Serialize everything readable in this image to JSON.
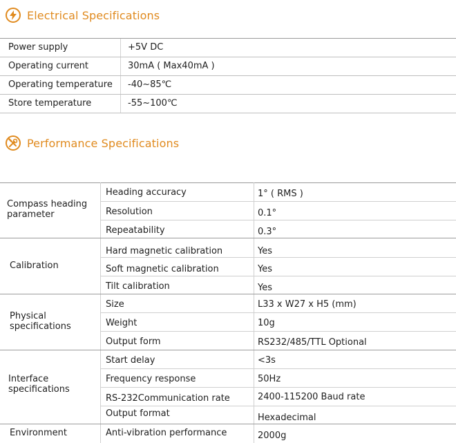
{
  "electrical": {
    "title": "Electrical Specifications",
    "rows": [
      {
        "name": "Power supply",
        "value": "+5V DC"
      },
      {
        "name": "Operating  current",
        "value": "30mA ( Max40mA )"
      },
      {
        "name": "Operating  temperature",
        "value": "-40~85℃"
      },
      {
        "name": "Store temperature",
        "value": "-55~100℃"
      }
    ]
  },
  "performance": {
    "title": "Performance Specifications",
    "groups": [
      {
        "label_lines": [
          "Compass heading",
          "parameter"
        ],
        "rows": [
          {
            "name": "Heading accuracy",
            "value": "1° ( RMS )"
          },
          {
            "name": "Resolution",
            "value": "0.1°"
          },
          {
            "name": "Repeatability",
            "value": "0.3°"
          }
        ]
      },
      {
        "label_lines": [
          "Calibration"
        ],
        "rows": [
          {
            "name": "Hard magnetic calibration",
            "value": "Yes"
          },
          {
            "name": "Soft magnetic calibration",
            "value": "Yes"
          },
          {
            "name": "Tilt calibration",
            "value": "Yes"
          }
        ]
      },
      {
        "label_lines": [
          "Physical",
          "specifications"
        ],
        "rows": [
          {
            "name": "Size",
            "value": "L33 x W27 x H5 (mm)"
          },
          {
            "name": "Weight",
            "value": "10g"
          },
          {
            "name": "Output form",
            "value": "RS232/485/TTL Optional"
          }
        ]
      },
      {
        "label_lines": [
          "Interface",
          "specifications"
        ],
        "rows": [
          {
            "name": "Start delay",
            "value": "<3s"
          },
          {
            "name": "Frequency response",
            "value": "50Hz"
          },
          {
            "name": "RS-232Communication rate",
            "value": "2400-115200 Baud rate"
          },
          {
            "name": "Output format",
            "value": "Hexadecimal"
          }
        ]
      },
      {
        "label_lines": [
          "Environment"
        ],
        "rows": [
          {
            "name": "Anti-vibration performance",
            "value": "2000g"
          }
        ]
      }
    ]
  },
  "icons": {
    "electrical": "lightning-bolt-icon",
    "performance": "tools-icon"
  },
  "colors": {
    "accent": "#e08a1e",
    "text": "#1e1e1e"
  }
}
